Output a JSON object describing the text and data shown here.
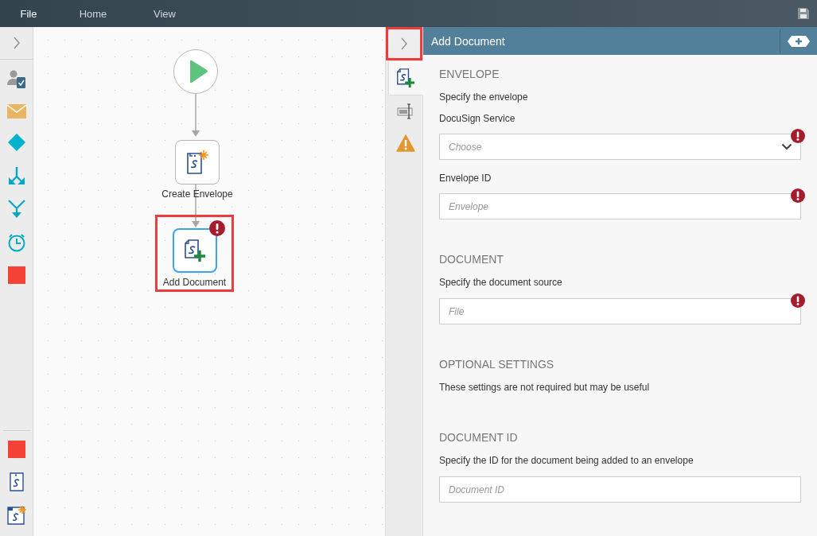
{
  "menu": [
    {
      "label": "File",
      "selected": true
    },
    {
      "label": "Home",
      "selected": false
    },
    {
      "label": "View",
      "selected": false
    }
  ],
  "toolbox": {
    "top": [
      {
        "kind": "task"
      },
      {
        "kind": "email"
      },
      {
        "kind": "decision"
      },
      {
        "kind": "split"
      },
      {
        "kind": "merge"
      },
      {
        "kind": "timer"
      },
      {
        "kind": "end"
      }
    ],
    "bottom": [
      {
        "kind": "end"
      },
      {
        "kind": "docusign"
      },
      {
        "kind": "docusign-new"
      }
    ]
  },
  "canvas": {
    "nodes": [
      {
        "kind": "start"
      },
      {
        "kind": "create",
        "label": "Create Envelope",
        "selected": false,
        "error": false,
        "highlighted": false
      },
      {
        "kind": "add",
        "label": "Add Document",
        "selected": true,
        "error": true,
        "highlighted": true
      }
    ]
  },
  "panel": {
    "collapse_highlighted": true,
    "title": "Add Document",
    "tabs": [
      {
        "kind": "docusign",
        "selected": true
      },
      {
        "kind": "fields",
        "selected": false
      },
      {
        "kind": "warning",
        "selected": false
      }
    ],
    "sections": [
      {
        "heading": "ENVELOPE",
        "description": "Specify the envelope",
        "fields": [
          {
            "label": "DocuSign Service",
            "placeholder": "Choose",
            "kind": "dropdown",
            "error": true
          },
          {
            "label": "Envelope ID",
            "placeholder": "Envelope",
            "kind": "text",
            "error": true
          }
        ]
      },
      {
        "heading": "DOCUMENT",
        "description": "Specify the document source",
        "fields": [
          {
            "placeholder": "File",
            "kind": "text",
            "error": true
          }
        ]
      },
      {
        "heading": "OPTIONAL SETTINGS",
        "description": "These settings are not required but may be useful"
      },
      {
        "heading": "DOCUMENT ID",
        "description": "Specify the ID for the document being added to an envelope",
        "fields": [
          {
            "placeholder": "Document ID",
            "kind": "text",
            "error": false
          }
        ]
      }
    ]
  }
}
